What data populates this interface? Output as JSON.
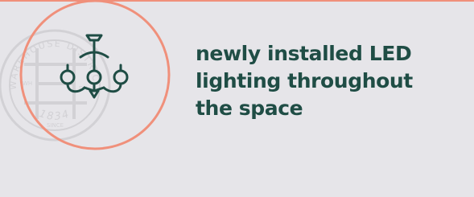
{
  "colors": {
    "background": "#e6e5e9",
    "accent": "#f0907b",
    "icon": "#1f4d45",
    "seal": "#d2d1d5",
    "text": "#1f4d45"
  },
  "icon": "chandelier-icon",
  "seal": {
    "logo": "warehouse-district-seal",
    "arc_text": "WAREHOUSE DISTRICT",
    "year": "1834",
    "small_left": "WH",
    "small_right": "DH",
    "small_bottom": "SINCE"
  },
  "feature": {
    "lines": [
      "newly installed LED",
      "lighting throughout",
      "the space"
    ]
  }
}
